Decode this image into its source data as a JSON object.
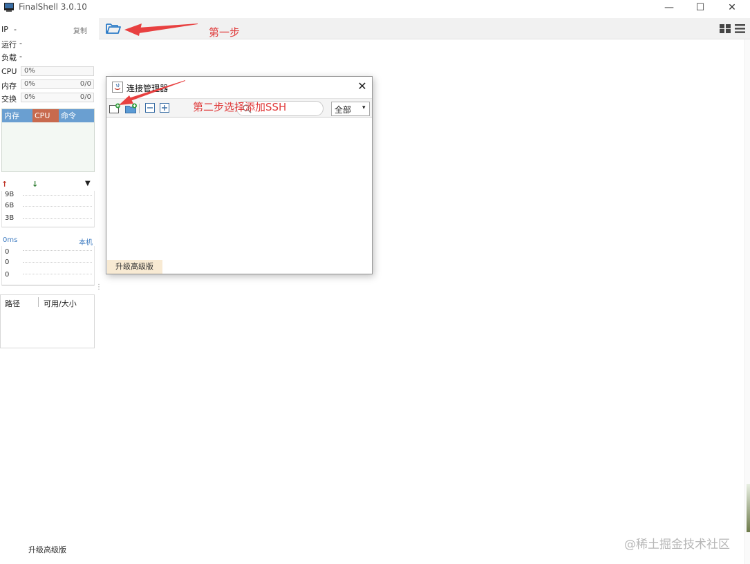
{
  "window": {
    "title": "FinalShell 3.0.10",
    "minimize": "—",
    "maximize": "☐",
    "close": "✕"
  },
  "left_panel": {
    "ip_label": "IP",
    "ip_value": "-",
    "copy": "复制",
    "uptime_label": "运行",
    "uptime_value": "-",
    "load_label": "负载",
    "load_value": "-",
    "cpu": {
      "label": "CPU",
      "percent": "0%"
    },
    "memory": {
      "label": "内存",
      "percent": "0%",
      "value": "0/0"
    },
    "swap": {
      "label": "交换",
      "percent": "0%",
      "value": "0/0"
    },
    "tabs": [
      "内存",
      "CPU",
      "命令"
    ],
    "network": {
      "up_icon": "↑",
      "down_icon": "↓",
      "menu_icon": "▼",
      "ticks": [
        "9B",
        "6B",
        "3B"
      ]
    },
    "ping": {
      "label": "0ms",
      "target": "本机",
      "ticks": [
        "0",
        "0",
        "0"
      ]
    },
    "splitter": "⋮",
    "fs": {
      "path_header": "路径",
      "size_header": "可用/大小"
    },
    "upgrade": "升级高级版"
  },
  "annotations": {
    "step1": "第一步",
    "step2": "第二步选择添加SSH"
  },
  "dialog": {
    "title": "连接管理器",
    "close": "✕",
    "filter_value": "全部",
    "filter_arrow": "▾",
    "upgrade": "升级高级版"
  },
  "watermark": "@稀土掘金技术社区",
  "colors": {
    "tab_bar": "#6a9fd1",
    "tab_active": "#c86a4e",
    "annotation": "#e03a3a",
    "accent_blue": "#3f7cc1"
  }
}
